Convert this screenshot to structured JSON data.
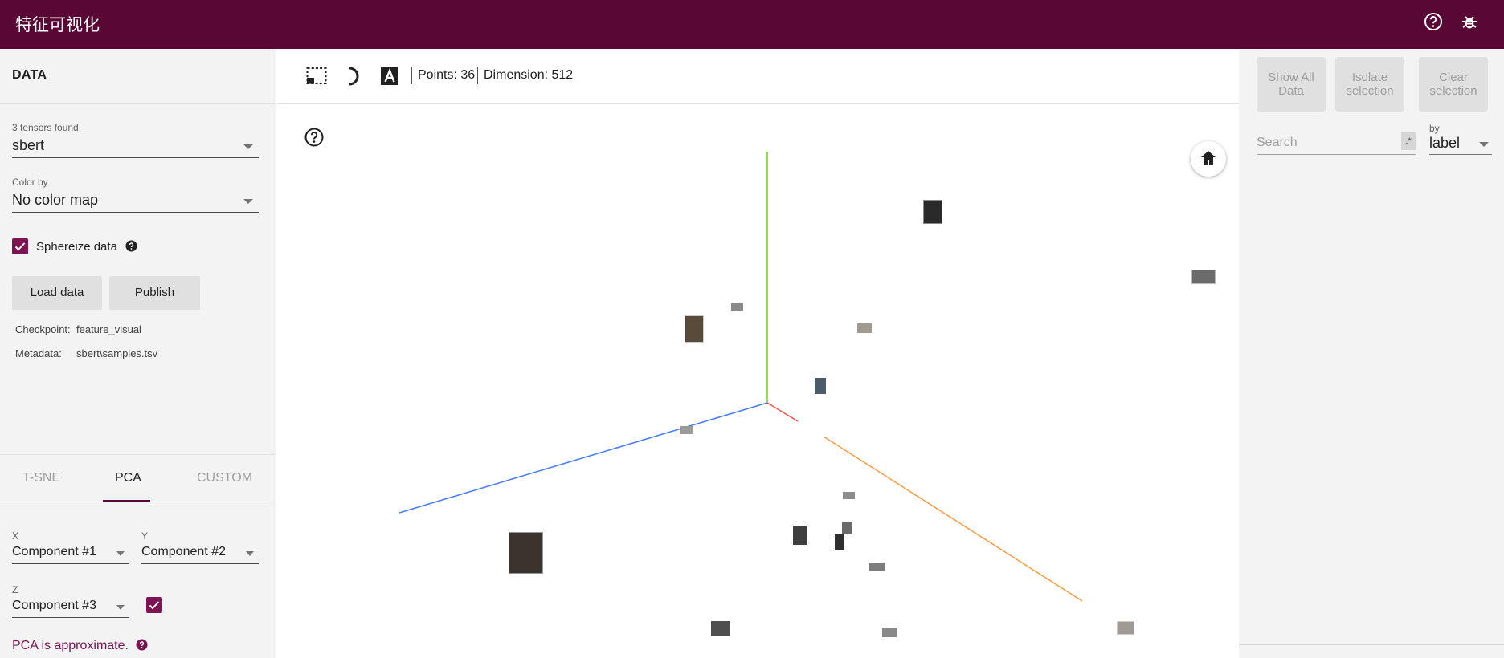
{
  "app": {
    "title": "特征可视化"
  },
  "header": {
    "help_icon": "help-circle-icon",
    "bug_icon": "bug-icon"
  },
  "data_panel": {
    "heading": "DATA",
    "tensors_label": "3 tensors found",
    "tensor_selected": "sbert",
    "color_by_label": "Color by",
    "color_by_value": "No color map",
    "sphereize_label": "Sphereize data",
    "sphereize_checked": true,
    "load_button": "Load data",
    "publish_button": "Publish",
    "checkpoint_key": "Checkpoint:",
    "checkpoint_val": "feature_visual",
    "metadata_key": "Metadata:",
    "metadata_val": "sbert\\samples.tsv"
  },
  "projection": {
    "tabs": [
      {
        "label": "T-SNE",
        "active": false
      },
      {
        "label": "PCA",
        "active": true
      },
      {
        "label": "CUSTOM",
        "active": false
      }
    ],
    "x_label": "X",
    "x_value": "Component #1",
    "y_label": "Y",
    "y_value": "Component #2",
    "z_label": "Z",
    "z_value": "Component #3",
    "z_enabled": true,
    "note": "PCA is approximate."
  },
  "toolbar": {
    "select_icon": "selection-box-icon",
    "night_icon": "night-mode-icon",
    "label_icon": "labels-icon",
    "points": "Points: 36",
    "dimension": "Dimension: 512"
  },
  "scene": {
    "help_icon": "help-circle-icon",
    "home_icon": "home-icon",
    "axis_colors": {
      "x": "#ff6a3d",
      "y": "#7ed321",
      "z": "#4a7dff"
    }
  },
  "inspector": {
    "show_all": "Show All Data",
    "isolate": "Isolate selection",
    "clear": "Clear selection",
    "search_placeholder": "Search",
    "regex_label": ".*",
    "by_label": "by",
    "by_value": "label"
  },
  "colors": {
    "brand": "#590735",
    "accent": "#7b1450"
  }
}
